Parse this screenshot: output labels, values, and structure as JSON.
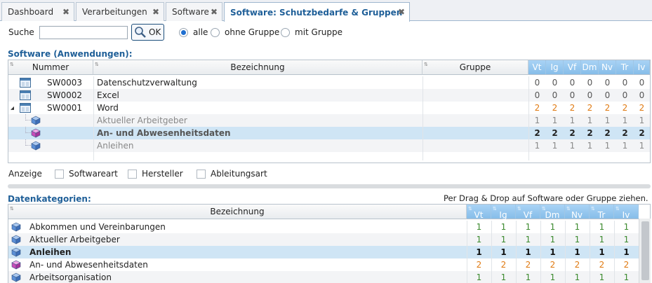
{
  "tabs": [
    {
      "label": "Dashboard",
      "close": "✖"
    },
    {
      "label": "Verarbeitungen",
      "close": "✖"
    },
    {
      "label": "Software",
      "close": "✖"
    },
    {
      "label": "Software: Schutzbedarfe & Gruppen",
      "close": "✖"
    }
  ],
  "search": {
    "label": "Suche",
    "value": "",
    "button_label": "OK"
  },
  "filter": {
    "options": [
      "alle",
      "ohne Gruppe",
      "mit Gruppe"
    ],
    "selected": "alle"
  },
  "software": {
    "title": "Software (Anwendungen):",
    "columns": {
      "nummer": "Nummer",
      "bezeichnung": "Bezeichnung",
      "gruppe": "Gruppe"
    },
    "metric_headers": [
      "Vt",
      "Ig",
      "Vf",
      "Dm",
      "Nv",
      "Tr",
      "Iv"
    ],
    "rows": [
      {
        "nummer": "SW0003",
        "bezeichnung": "Datenschutzverwaltung",
        "gruppe": "",
        "values": [
          "0",
          "0",
          "0",
          "0",
          "0",
          "0",
          "0"
        ],
        "style": "plain"
      },
      {
        "nummer": "SW0002",
        "bezeichnung": "Excel",
        "gruppe": "",
        "values": [
          "0",
          "0",
          "0",
          "0",
          "0",
          "0",
          "0"
        ],
        "style": "alt"
      },
      {
        "nummer": "SW0001",
        "bezeichnung": "Word",
        "gruppe": "",
        "values": [
          "2",
          "2",
          "2",
          "2",
          "2",
          "2",
          "2"
        ],
        "style": "plain",
        "expander": "◢"
      },
      {
        "nummer": "",
        "bezeichnung": "Aktueller Arbeitgeber",
        "gruppe": "",
        "values": [
          "1",
          "1",
          "1",
          "1",
          "1",
          "1",
          "1"
        ],
        "style": "alt"
      },
      {
        "nummer": "",
        "bezeichnung": "An- und Abwesenheitsdaten",
        "gruppe": "",
        "values": [
          "2",
          "2",
          "2",
          "2",
          "2",
          "2",
          "2"
        ],
        "style": "sel"
      },
      {
        "nummer": "",
        "bezeichnung": "Anleihen",
        "gruppe": "",
        "values": [
          "1",
          "1",
          "1",
          "1",
          "1",
          "1",
          "1"
        ],
        "style": "alt"
      }
    ]
  },
  "anzeige": {
    "label": "Anzeige",
    "options": [
      "Softwareart",
      "Hersteller",
      "Ableitungsart"
    ]
  },
  "datenkategorien": {
    "title": "Datenkategorien:",
    "hint": "Per Drag & Drop auf Software oder Gruppe ziehen.",
    "column": "Bezeichnung",
    "metric_headers": [
      "Vt",
      "Ig",
      "Vf",
      "Dm",
      "Nv",
      "Tr",
      "Iv"
    ],
    "rows": [
      {
        "bezeichnung": "Abkommen und Vereinbarungen",
        "values": [
          "1",
          "1",
          "1",
          "1",
          "1",
          "1",
          "1"
        ],
        "style": "plain"
      },
      {
        "bezeichnung": "Aktueller Arbeitgeber",
        "values": [
          "1",
          "1",
          "1",
          "1",
          "1",
          "1",
          "1"
        ],
        "style": "alt"
      },
      {
        "bezeichnung": "Anleihen",
        "values": [
          "1",
          "1",
          "1",
          "1",
          "1",
          "1",
          "1"
        ],
        "style": "sel"
      },
      {
        "bezeichnung": "An- und Abwesenheitsdaten",
        "values": [
          "2",
          "2",
          "2",
          "2",
          "2",
          "2",
          "2"
        ],
        "style": "plain"
      },
      {
        "bezeichnung": "Arbeitsorganisation",
        "values": [
          "1",
          "1",
          "1",
          "1",
          "1",
          "1",
          "1"
        ],
        "style": "alt"
      }
    ]
  },
  "colors": {
    "accent": "#1f5f98",
    "value_two": "#e07a12",
    "value_one_green": "#3c8a2e",
    "header_blue": "#8cc2ec",
    "selected_row": "#cfe5f5"
  }
}
